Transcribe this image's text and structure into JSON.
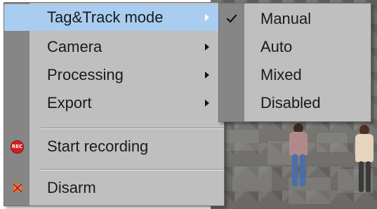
{
  "menu": {
    "items": [
      {
        "label": "Tag&Track mode",
        "has_submenu": true,
        "highlighted": true
      },
      {
        "label": "Camera",
        "has_submenu": true
      },
      {
        "label": "Processing",
        "has_submenu": true
      },
      {
        "label": "Export",
        "has_submenu": true
      },
      {
        "label": "Start recording",
        "icon": "record-icon",
        "icon_text": "REC"
      },
      {
        "label": "Disarm",
        "icon": "disarm-icon"
      }
    ]
  },
  "submenu": {
    "items": [
      {
        "label": "Manual",
        "checked": true
      },
      {
        "label": "Auto"
      },
      {
        "label": "Mixed"
      },
      {
        "label": "Disabled"
      }
    ]
  },
  "colors": {
    "menu_background": "#bfbfbf",
    "gutter": "#868686",
    "highlight": "#a9cdf0",
    "record": "#d51f1f",
    "disarm": "#f2c419"
  }
}
